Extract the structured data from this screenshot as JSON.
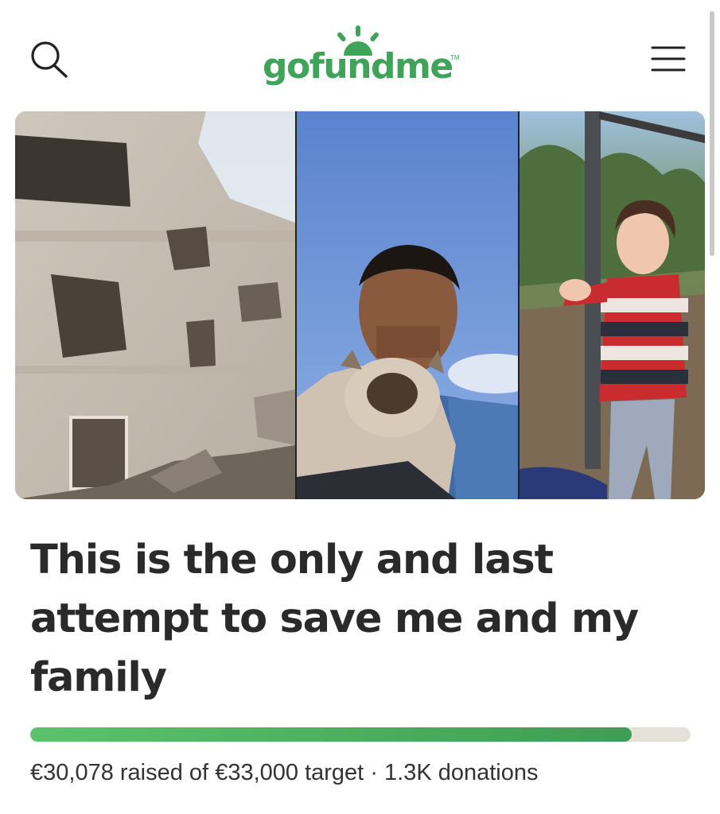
{
  "header": {
    "logo_text": "gofundme",
    "logo_tm": "TM",
    "search_icon": "search-icon",
    "menu_icon": "hamburger-menu-icon"
  },
  "gallery": {
    "photos": [
      {
        "subject": "damaged-building-photo"
      },
      {
        "subject": "man-with-cat-selfie-photo"
      },
      {
        "subject": "child-in-striped-sweater-photo"
      }
    ]
  },
  "campaign": {
    "title": "This is the only and last attempt to save me and my family",
    "raised": "€30,078",
    "raised_of_label": "raised of",
    "target": "€33,000",
    "target_label": "target",
    "separator": "·",
    "donations": "1.3K",
    "donations_label": "donations",
    "progress_fraction": 0.911
  },
  "colors": {
    "brand_green": "#3fa35a",
    "progress_fill": "#4bb460",
    "progress_track": "#e6e1d8"
  }
}
